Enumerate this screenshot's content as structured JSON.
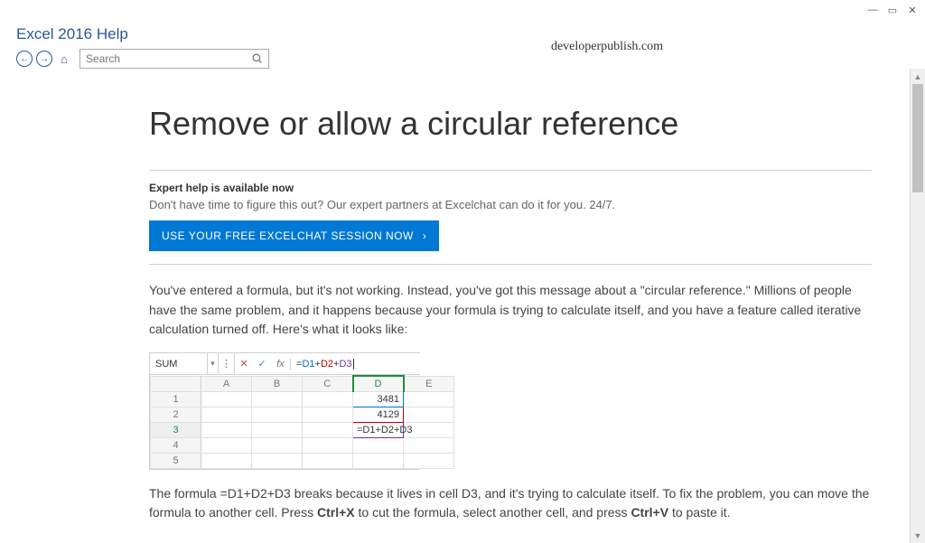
{
  "window": {
    "minimize": "—",
    "maximize": "▭",
    "close": "✕"
  },
  "header": {
    "app_title": "Excel 2016 Help",
    "back_arrow": "←",
    "forward_arrow": "→",
    "home_icon": "⌂",
    "search_placeholder": "Search",
    "search_icon": "🔍"
  },
  "watermark": "developerpublish.com",
  "article": {
    "title": "Remove or allow a circular reference",
    "notice_head": "Expert help is available now",
    "notice_body": "Don't have time to figure this out? Our expert partners at Excelchat can do it for you. 24/7.",
    "cta_label": "USE YOUR FREE EXCELCHAT SESSION NOW",
    "cta_arrow": "›",
    "para1": "You've entered a formula, but it's not working. Instead, you've got this message about a \"circular reference.\" Millions of people have the same problem, and it happens because your formula is trying to calculate itself, and you have a feature called iterative calculation turned off. Here's what it looks like:",
    "para2_a": "The formula =D1+D2+D3 breaks because it lives in cell D3, and it's trying to calculate itself. To fix the problem, you can move the formula to another cell. Press ",
    "para2_b": "Ctrl+X",
    "para2_c": " to cut the formula, select another cell, and press ",
    "para2_d": "Ctrl+V",
    "para2_e": " to paste it."
  },
  "excel_embed": {
    "name_box": "SUM",
    "dropdown": "▼",
    "more": "⋮",
    "cancel": "✕",
    "check": "✓",
    "fx_label": "fx",
    "formula_p1": "=",
    "formula_p2": "D1",
    "formula_p3": "+",
    "formula_p4": "D2",
    "formula_p5": "+",
    "formula_p6": "D3",
    "cols": [
      "A",
      "B",
      "C",
      "D",
      "E"
    ],
    "rows": [
      "1",
      "2",
      "3",
      "4",
      "5"
    ],
    "d1": "3481",
    "d2": "4129",
    "d3": "=D1+D2+D3"
  },
  "scrollbar": {
    "up": "▲",
    "down": "▼"
  }
}
